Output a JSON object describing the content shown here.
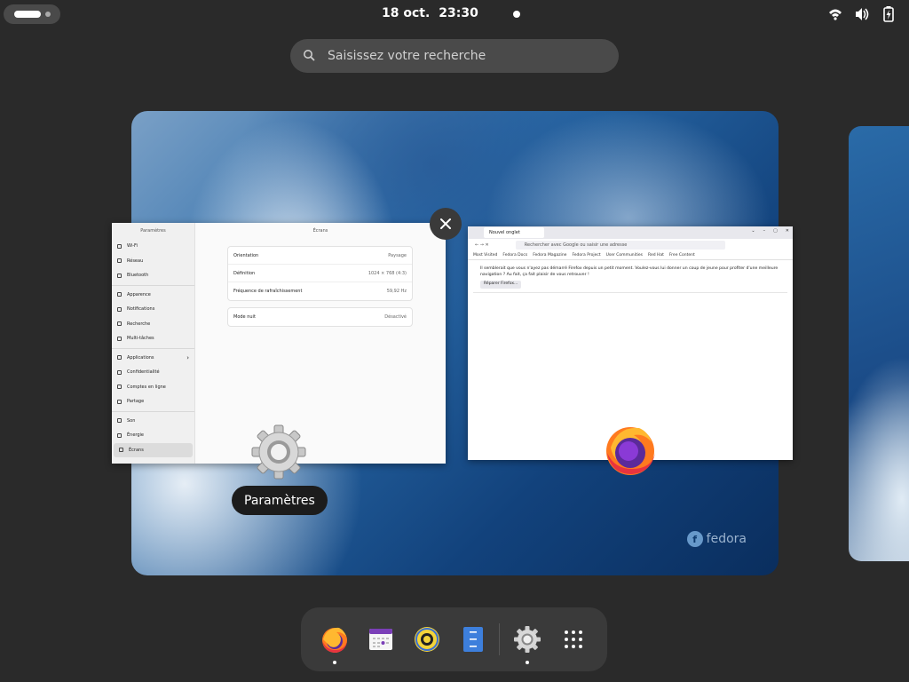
{
  "topbar": {
    "date": "18 oct.",
    "time": "23:30",
    "status_icons": [
      "wifi-icon",
      "volume-icon",
      "battery-charging-icon"
    ]
  },
  "search": {
    "placeholder": "Saisissez votre recherche"
  },
  "settings_window": {
    "sidebar_title": "Paramètres",
    "sidebar_items": [
      {
        "label": "Wi-Fi"
      },
      {
        "label": "Réseau"
      },
      {
        "label": "Bluetooth"
      },
      {
        "label": "Apparence"
      },
      {
        "label": "Notifications"
      },
      {
        "label": "Recherche"
      },
      {
        "label": "Multi-tâches"
      },
      {
        "label": "Applications"
      },
      {
        "label": "Confidentialité"
      },
      {
        "label": "Comptes en ligne"
      },
      {
        "label": "Partage"
      },
      {
        "label": "Son"
      },
      {
        "label": "Énergie"
      },
      {
        "label": "Écrans"
      }
    ],
    "page_title": "Écrans",
    "rows": [
      {
        "label": "Orientation",
        "value": "Paysage"
      },
      {
        "label": "Définition",
        "value": "1024 × 768 (4:3)"
      },
      {
        "label": "Fréquence de rafraîchissement",
        "value": "59,92 Hz"
      }
    ],
    "night": {
      "label": "Mode nuit",
      "value": "Désactivé"
    }
  },
  "firefox_window": {
    "tab_title": "Nouvel onglet",
    "url_placeholder": "Rechercher avec Google ou saisir une adresse",
    "bookmarks": [
      "Most Visited",
      "Fedora Docs",
      "Fedora Magazine",
      "Fedora Project",
      "User Communities",
      "Red Hat",
      "Free Content"
    ],
    "notice_text": "Il semblerait que vous n'ayez pas démarré Firefox depuis un petit moment. Voulez-vous lui donner un coup de jeune pour profiter d'une meilleure navigation ? Au fait, ça fait plaisir de vous retrouver !",
    "notice_button": "Réparer Firefox..."
  },
  "wallpaper": {
    "brand": "fedora"
  },
  "tooltip": {
    "label": "Paramètres"
  },
  "dock": {
    "apps": [
      "firefox-icon",
      "calendar-icon",
      "rhythmbox-icon",
      "files-icon",
      "settings-icon",
      "app-grid-icon"
    ]
  }
}
